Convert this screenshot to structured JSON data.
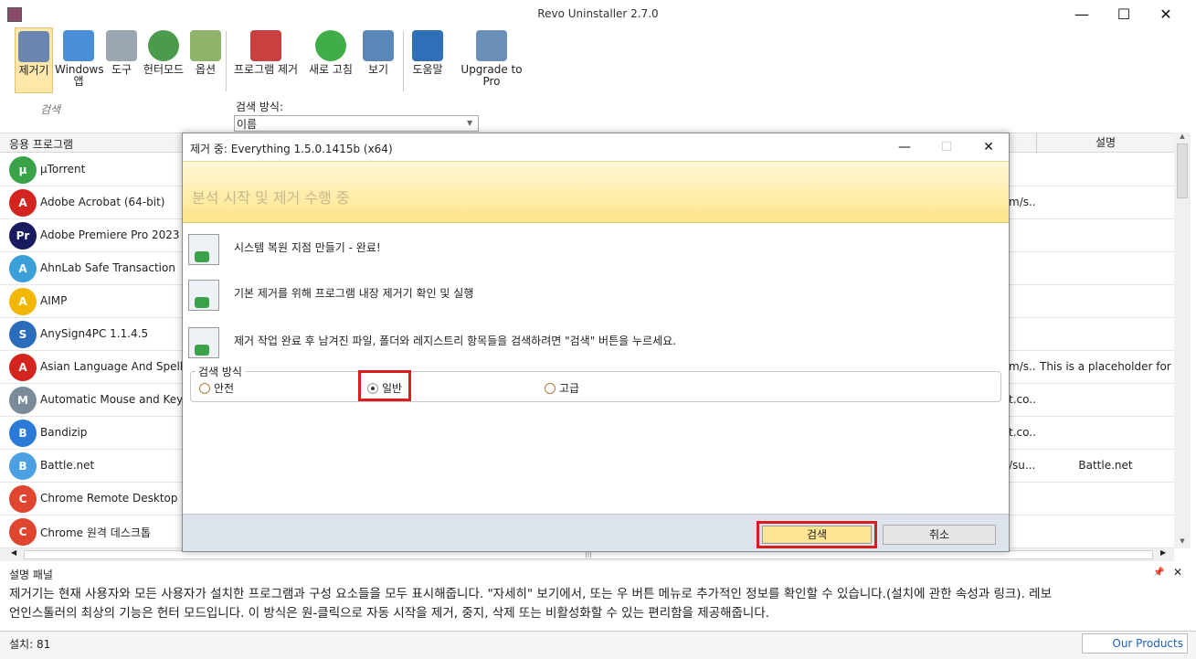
{
  "window": {
    "title": "Revo Uninstaller 2.7.0",
    "minimize": "—",
    "maximize": "☐",
    "close": "✕"
  },
  "toolbar": {
    "uninstaller": "제거기",
    "windows_apps_1": "Windows",
    "windows_apps_2": "앱",
    "tools": "도구",
    "hunter_mode": "헌터모드",
    "options": "옵션",
    "uninstall": "프로그램 제거",
    "refresh": "새로 고침",
    "view": "보기",
    "help": "도움말",
    "upgrade": "Upgrade to Pro"
  },
  "search": {
    "placeholder": "검색",
    "method_label": "검색 방식:",
    "method_value": "이름"
  },
  "list": {
    "header_app": "응용 프로그램",
    "header_desc": "설명",
    "rows": [
      {
        "name": "µTorrent",
        "url": "",
        "desc": "",
        "color": "#3aa34a",
        "letter": "µ"
      },
      {
        "name": "Adobe Acrobat (64-bit)",
        "url": "m/s...",
        "desc": "",
        "color": "#d4241f",
        "letter": "A"
      },
      {
        "name": "Adobe Premiere Pro 2023",
        "url": "",
        "desc": "",
        "color": "#1a1a5e",
        "letter": "Pr"
      },
      {
        "name": "AhnLab Safe Transaction",
        "url": "",
        "desc": "",
        "color": "#3b9fd8",
        "letter": "A"
      },
      {
        "name": "AIMP",
        "url": "",
        "desc": "",
        "color": "#f2b705",
        "letter": "A"
      },
      {
        "name": "AnySign4PC 1.1.4.5",
        "url": "",
        "desc": "",
        "color": "#2a6ebb",
        "letter": "S"
      },
      {
        "name": "Asian Language And Spelling",
        "url": "m/s...",
        "desc": "This is a placeholder for ...",
        "color": "#d4241f",
        "letter": "A"
      },
      {
        "name": "Automatic Mouse and Keybo",
        "url": "t.co...",
        "desc": "",
        "color": "#7a8a99",
        "letter": "M"
      },
      {
        "name": "Bandizip",
        "url": "t.co...",
        "desc": "",
        "color": "#2a7bd8",
        "letter": "B"
      },
      {
        "name": "Battle.net",
        "url": "/su...",
        "desc": "Battle.net",
        "color": "#4aa0e0",
        "letter": "B"
      },
      {
        "name": "Chrome Remote Desktop Ho",
        "url": "",
        "desc": "",
        "color": "#e0452f",
        "letter": "C"
      },
      {
        "name": "Chrome 원격 데스크톱",
        "url": "",
        "desc": "",
        "color": "#e0452f",
        "letter": "C"
      }
    ]
  },
  "dialog": {
    "title": "제거 중: Everything 1.5.0.1415b (x64)",
    "banner": "분석 시작 및 제거 수행 중",
    "step1": "시스템 복원 지점 만들기 - 완료!",
    "step2": "기본 제거를 위해 프로그램 내장 제거기 확인 및 실행",
    "step3": "제거 작업 완료 후 남겨진 파일, 폴더와 레지스트리 항목들을 검색하려면 \"검색\" 버튼을 누르세요.",
    "scan_group": "검색 방식",
    "safe": "안전",
    "moderate": "일반",
    "advanced": "고급",
    "search_button": "검색",
    "cancel_button": "취소"
  },
  "description_panel": {
    "title": "설명 패널",
    "line1": "제거기는 현재 사용자와 모든 사용자가 설치한 프로그램과 구성 요소들을 모두 표시해줍니다. \"자세히\" 보기에서, 또는 우 버튼 메뉴로 추가적인 정보를 확인할 수 있습니다.(설치에 관한 속성과 링크). 레보",
    "line2": "언인스톨러의 최상의 기능은 헌터 모드입니다. 이 방식은 원-클릭으로 자동 시작을 제거, 중지, 삭제 또는 비활성화할 수 있는 편리함을 제공해줍니다."
  },
  "status": {
    "installed": "설치: 81",
    "our_products": "Our Products"
  },
  "colors": {
    "accent": "#fde596",
    "highlight": "#d81e1e",
    "banner": "#fde58a"
  }
}
